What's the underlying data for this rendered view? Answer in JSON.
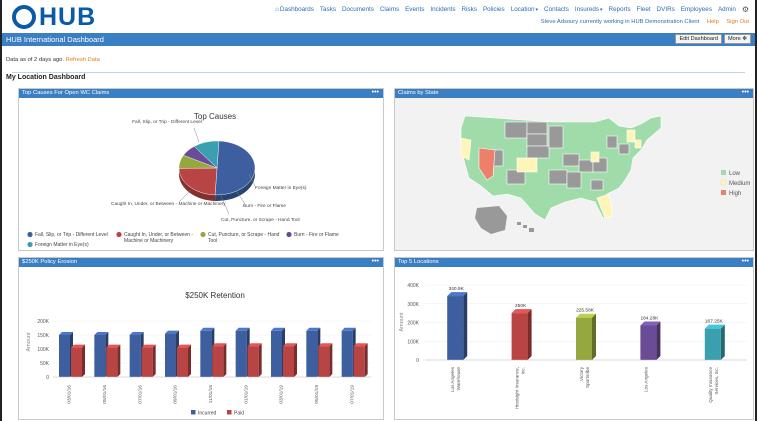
{
  "brand": {
    "logo_text": "HUB"
  },
  "nav": {
    "items": [
      "Dashboards",
      "Tasks",
      "Documents",
      "Claims",
      "Events",
      "Incidents",
      "Risks",
      "Policies",
      "Location",
      "Contacts",
      "Insureds",
      "Reports",
      "Fleet",
      "DVIRs",
      "Employees",
      "Admin"
    ],
    "status": "Steve Adsoury currently working in HUB Demonstration Client",
    "help": "Help",
    "sign_out": "Sign Out"
  },
  "page": {
    "title": "HUB International Dashboard",
    "edit_button": "Edit Dashboard",
    "more_button": "More",
    "as_of": "Data as of 2 days ago.",
    "refresh": "Refresh Data",
    "dashboard_title": "My Location Dashboard"
  },
  "panels": {
    "top_causes": "Top Causes For Open WC Claims",
    "claims_by_state": "Claims by State",
    "policy_erosion": "$250K Policy Erosion",
    "top_locations": "Top 5 Locations",
    "menu_icon": "•••"
  },
  "chart_data": [
    {
      "type": "pie",
      "title": "Top Causes",
      "slices": [
        {
          "label": "Fall, Slip, or Trip - Different Level",
          "value": 50,
          "color": "#3d5fa0"
        },
        {
          "label": "Caught In, Under, or Between - Machine or Machinery",
          "value": 24,
          "color": "#b94444"
        },
        {
          "label": "Cut, Puncture, or Scrape - Hand Tool",
          "value": 8,
          "color": "#95a83e"
        },
        {
          "label": "Burn - Fire or Flame",
          "value": 7,
          "color": "#6a4b96"
        },
        {
          "label": "Foreign Matter in Eye(s)",
          "value": 11,
          "color": "#3a9fae"
        }
      ],
      "legend": [
        {
          "label": "Fall, Slip, or Trip - Different Level",
          "color": "#3d5fa0"
        },
        {
          "label": "Caught In, Under, or Between - Machine or Machinery",
          "color": "#b94444"
        },
        {
          "label": "Cut, Puncture, or Scrape - Hand Tool",
          "color": "#95a83e"
        },
        {
          "label": "Burn - Fire or Flame",
          "color": "#6a4b96"
        },
        {
          "label": "Foreign Matter in Eye(s)",
          "color": "#3a9fae"
        }
      ]
    },
    {
      "type": "map",
      "legend": [
        {
          "label": "Low",
          "color": "#9fdcaa"
        },
        {
          "label": "Medium",
          "color": "#fff5b8"
        },
        {
          "label": "High",
          "color": "#ee7f6a"
        }
      ]
    },
    {
      "type": "bar",
      "title": "$250K Retention",
      "ylabel": "Amount",
      "ylim": [
        0,
        250000
      ],
      "ytick_labels": [
        "0",
        "50K",
        "100K",
        "150K",
        "200K",
        "250K"
      ],
      "categories": [
        "03/01/16",
        "05/01/16",
        "07/01/16",
        "09/01/16",
        "11/01/16",
        "01/01/19",
        "03/01/19",
        "05/01/19",
        "07/01/19"
      ],
      "series": [
        {
          "name": "Incurred",
          "color": "#3d5fa0",
          "values": [
            150000,
            150000,
            150000,
            155000,
            165000,
            165000,
            165000,
            165000,
            165000
          ]
        },
        {
          "name": "Paid",
          "color": "#b94444",
          "values": [
            105000,
            105000,
            105000,
            105000,
            110000,
            110000,
            110000,
            110000,
            110000
          ]
        }
      ]
    },
    {
      "type": "bar",
      "ylabel": "Amount",
      "ylim": [
        0,
        400000
      ],
      "ytick_labels": [
        "0",
        "100K",
        "200K",
        "300K",
        "400K"
      ],
      "categories": [
        "Los Angeles Warehouse",
        "Hindsight Insurance, Inc.",
        "Victory Sportsribe",
        "Los Angeles",
        "Quality Insurance Services, Inc."
      ],
      "values": [
        340900,
        250000,
        225580,
        184280,
        167250
      ],
      "value_labels": [
        "340.9K",
        "250K",
        "225.58K",
        "184.28K",
        "167.25K"
      ],
      "colors": [
        "#3d5fa0",
        "#b94444",
        "#95a83e",
        "#6a4b96",
        "#3a9fae"
      ]
    }
  ]
}
